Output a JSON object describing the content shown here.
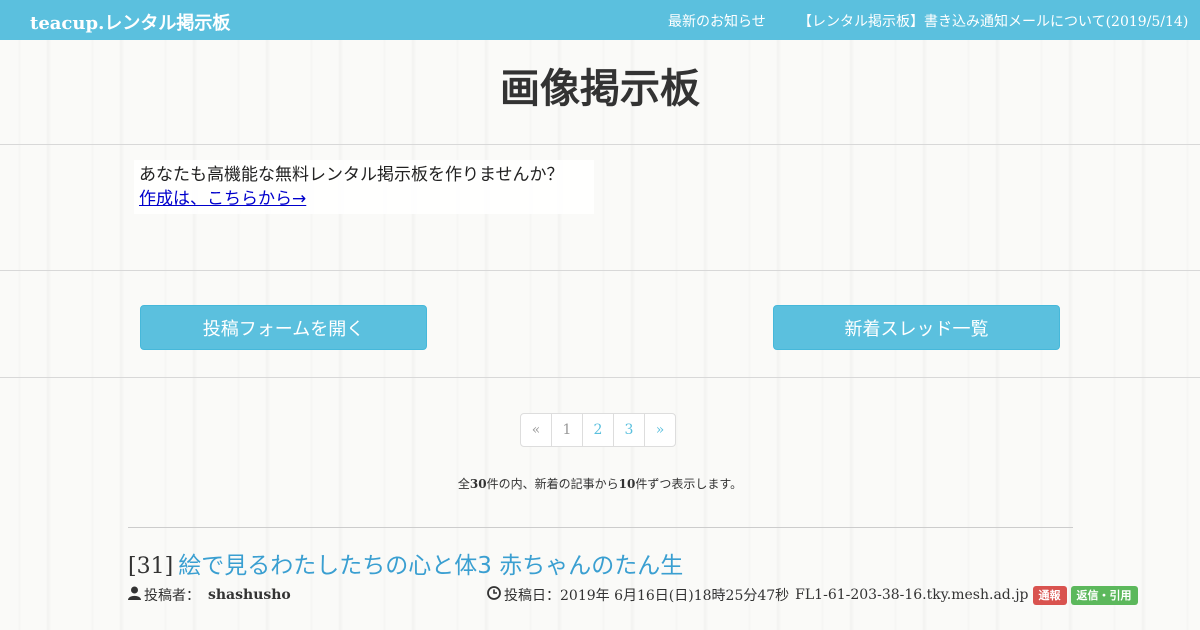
{
  "navbar": {
    "brand": "teacup.レンタル掲示板",
    "news_link": "最新のお知らせ",
    "notice_link": "【レンタル掲示板】書き込み通知メールについて(2019/5/14)"
  },
  "page_title": "画像掲示板",
  "promo": {
    "text": "あなたも高機能な無料レンタル掲示板を作りませんか？",
    "link": "作成は、こちらから→"
  },
  "buttons": {
    "open_form": "投稿フォームを開く",
    "new_threads": "新着スレッド一覧"
  },
  "pagination": {
    "prev": "«",
    "pages": [
      "1",
      "2",
      "3"
    ],
    "next": "»",
    "current": "1"
  },
  "summary": {
    "prefix": "全",
    "total": "30",
    "middle": "件の内、新着の記事から",
    "per_page": "10",
    "suffix": "件ずつ表示します。"
  },
  "post": {
    "number": "[31]",
    "subject": "絵で見るわたしたちの心と体3 赤ちゃんのたん生",
    "author_label": "投稿者：",
    "author": "shashusho",
    "date_label": "投稿日：",
    "date": "2019年 6月16日(日)18時25分47秒",
    "host": "FL1-61-203-38-16.tky.mesh.ad.jp",
    "report_badge": "通報",
    "reply_badge": "返信・引用"
  },
  "colors": {
    "accent": "#5bc0de",
    "link": "#3a9fd1",
    "report": "#d9534f",
    "reply": "#5cb85c"
  }
}
